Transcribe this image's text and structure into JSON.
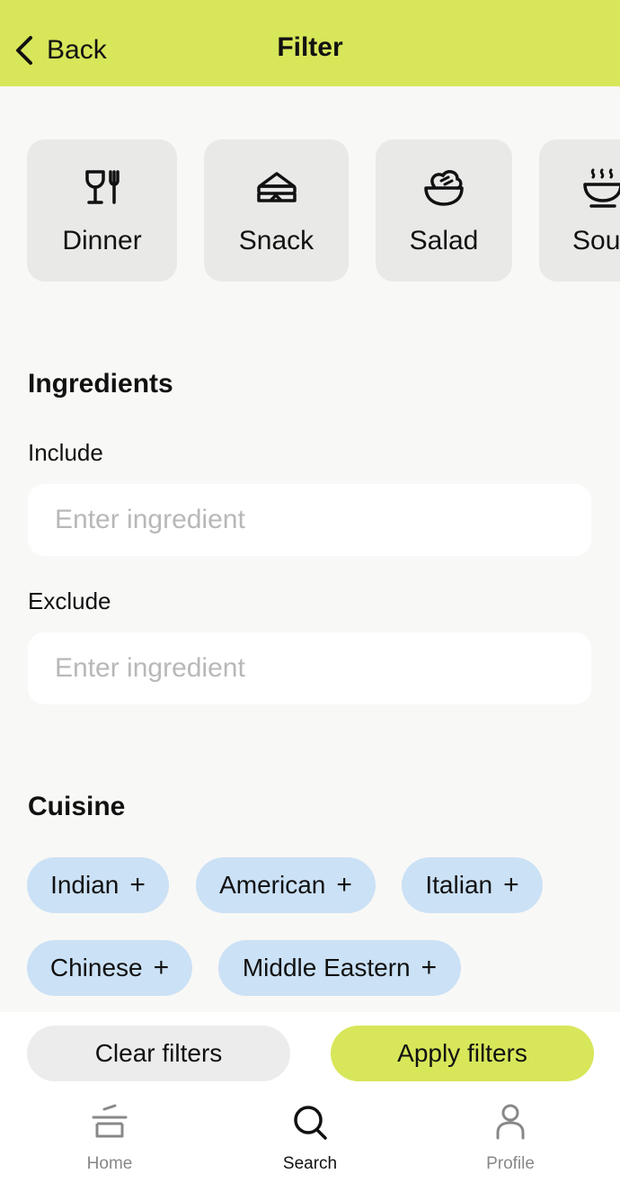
{
  "header": {
    "back_label": "Back",
    "title": "Filter",
    "background": "#d8e65a"
  },
  "categories": [
    {
      "label": "Dinner",
      "icon": "wine-fork-icon"
    },
    {
      "label": "Snack",
      "icon": "sandwich-icon"
    },
    {
      "label": "Salad",
      "icon": "salad-bowl-icon"
    },
    {
      "label": "Soup",
      "icon": "soup-bowl-icon"
    }
  ],
  "ingredients": {
    "title": "Ingredients",
    "include_label": "Include",
    "include_placeholder": "Enter ingredient",
    "exclude_label": "Exclude",
    "exclude_placeholder": "Enter ingredient"
  },
  "cuisine": {
    "title": "Cuisine",
    "chips": [
      "Indian",
      "American",
      "Italian",
      "Chinese",
      "Middle Eastern"
    ],
    "chip_color": "#cbe1f5"
  },
  "actions": {
    "clear_label": "Clear filters",
    "apply_label": "Apply filters",
    "apply_color": "#d8e65a"
  },
  "tabbar": {
    "items": [
      {
        "label": "Home",
        "icon": "cooking-pot-icon",
        "active": false
      },
      {
        "label": "Search",
        "icon": "search-icon",
        "active": true
      },
      {
        "label": "Profile",
        "icon": "user-icon",
        "active": false
      }
    ],
    "active_color": "#111111",
    "inactive_color": "#888888"
  }
}
